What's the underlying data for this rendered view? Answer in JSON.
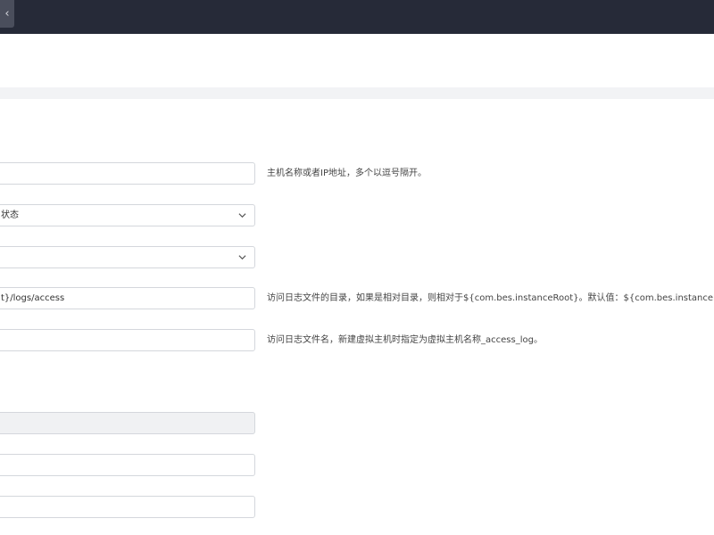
{
  "header": {
    "back_icon": "chevron-left-icon",
    "back_glyph": "‹"
  },
  "form": {
    "host": {
      "value": "",
      "hint": "主机名称或者IP地址，多个以逗号隔开。"
    },
    "status_select": {
      "value": "状态",
      "icon": "chevron-down-icon"
    },
    "second_select": {
      "value": "",
      "icon": "chevron-down-icon"
    },
    "log_dir": {
      "value": "t}/logs/access",
      "hint": "访问日志文件的目录，如果是相对目录，则相对于${com.bes.instanceRoot}。默认值：${com.bes.instanceRoot}/"
    },
    "log_name": {
      "value": "",
      "hint": "访问日志文件名，新建虚拟主机时指定为虚拟主机名称_access_log。"
    },
    "disabled_field": {
      "value": ""
    },
    "field_a": {
      "value": ""
    },
    "field_b": {
      "value": ""
    }
  }
}
